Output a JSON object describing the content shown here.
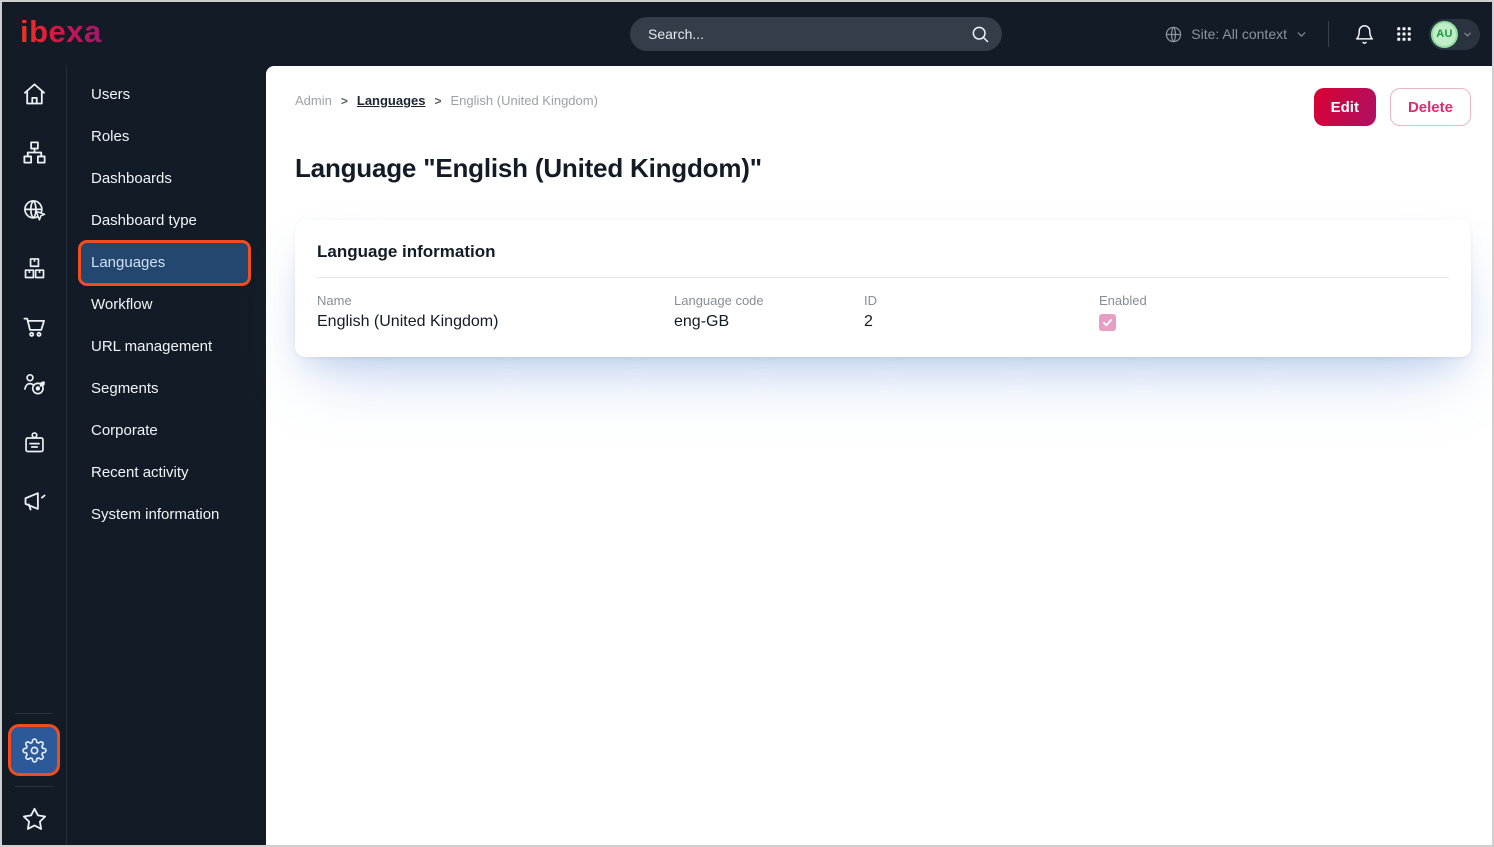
{
  "topbar": {
    "logo_text": "ibexa",
    "search": {
      "placeholder": "Search..."
    },
    "site_context_label": "Site: All context",
    "user_initials": "AU"
  },
  "icon_rail": {
    "items": [
      "home",
      "content-structure",
      "site",
      "products",
      "commerce",
      "personalization",
      "corporate",
      "marketing"
    ],
    "bottom_items": [
      "settings",
      "favorites"
    ],
    "active_item": "settings"
  },
  "sidebar": {
    "items": [
      {
        "label": "Users",
        "active": false
      },
      {
        "label": "Roles",
        "active": false
      },
      {
        "label": "Dashboards",
        "active": false
      },
      {
        "label": "Dashboard type",
        "active": false
      },
      {
        "label": "Languages",
        "active": true,
        "highlighted": true
      },
      {
        "label": "Workflow",
        "active": false
      },
      {
        "label": "URL management",
        "active": false
      },
      {
        "label": "Segments",
        "active": false
      },
      {
        "label": "Corporate",
        "active": false
      },
      {
        "label": "Recent activity",
        "active": false
      },
      {
        "label": "System information",
        "active": false
      }
    ]
  },
  "main": {
    "breadcrumb": [
      {
        "label": "Admin"
      },
      {
        "label": "Languages"
      },
      {
        "label": "English (United Kingdom)"
      }
    ],
    "breadcrumb_separator": ">",
    "actions": {
      "edit_label": "Edit",
      "delete_label": "Delete"
    },
    "page_title": "Language \"English (United Kingdom)\"",
    "card": {
      "title": "Language information",
      "fields": [
        {
          "label": "Name",
          "value": "English (United Kingdom)"
        },
        {
          "label": "Language code",
          "value": "eng-GB"
        },
        {
          "label": "ID",
          "value": "2"
        },
        {
          "label": "Enabled",
          "value": true,
          "type": "checkbox"
        }
      ]
    }
  },
  "colors": {
    "topbar_bg": "#131c26",
    "active_menu_bg": "#24476f",
    "settings_box_bg": "#2c5a99",
    "annotation_highlight": "#f34d1e",
    "primary_gradient": [
      "#db0032",
      "#ae1164"
    ],
    "delete_text": "#d62e6e",
    "checkbox_checked": "#e79ec4",
    "avatar_green": "#1a9b3e"
  },
  "annotations": {
    "highlighted_elements": [
      "sidebar-item-languages",
      "settings-button"
    ]
  }
}
